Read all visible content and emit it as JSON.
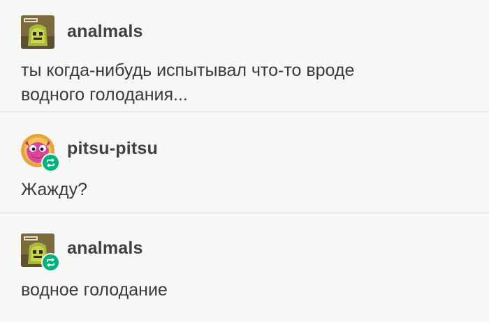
{
  "posts": [
    {
      "username": "analmals",
      "avatar_icon": "avatar-green-monster-icon",
      "reblogged": false,
      "lines": [
        "ты когда-нибудь испытывал что-то вроде",
        "водного голодания..."
      ]
    },
    {
      "username": "pitsu-pitsu",
      "avatar_icon": "avatar-pink-creature-icon",
      "reblogged": true,
      "lines": [
        "Жажду?"
      ]
    },
    {
      "username": "analmals",
      "avatar_icon": "avatar-green-monster-icon",
      "reblogged": true,
      "lines": [
        "водное голодание"
      ]
    }
  ],
  "colors": {
    "background": "#f7f7f5",
    "text": "#3a3a3a",
    "divider": "#d9d9d6",
    "reblog_badge": "#00b37e"
  }
}
